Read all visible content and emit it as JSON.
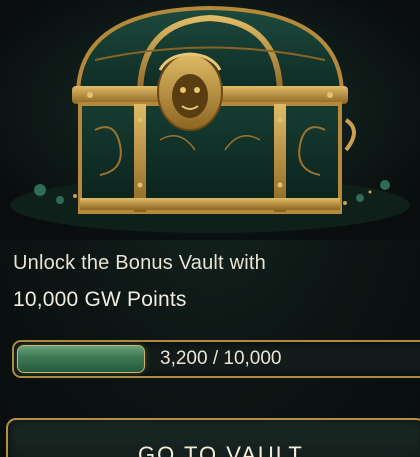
{
  "hero": {
    "image_name": "treasure-chest-illustration"
  },
  "vault": {
    "headline_line1": "Unlock the Bonus Vault with",
    "headline_line2": "10,000 GW Points",
    "progress_text": "3,200 / 10,000",
    "progress_current": 3200,
    "progress_target": 10000,
    "progress_fraction": 0.32,
    "button_label": "GO TO VAULT"
  },
  "colors": {
    "background": "#0b1012",
    "gold_accent": "#b08a3e",
    "progress_green": "#3f7a56",
    "text_light": "#ebe5d6"
  }
}
